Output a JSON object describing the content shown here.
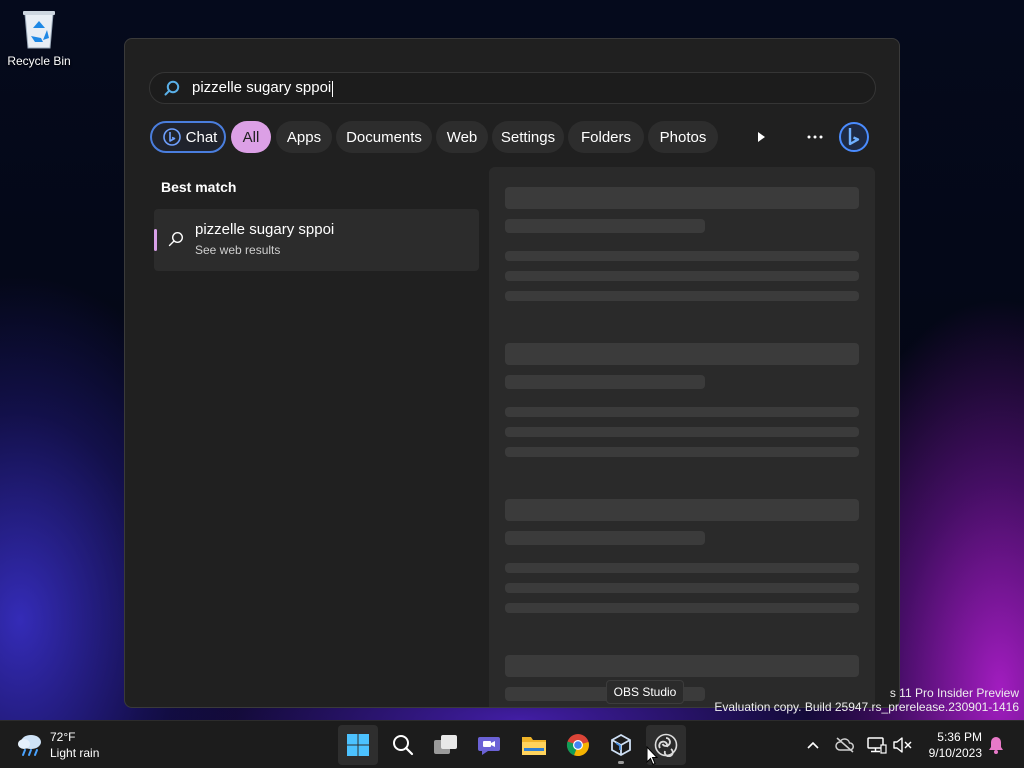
{
  "desktop": {
    "recycle_bin_label": "Recycle Bin"
  },
  "search": {
    "query": "pizzelle sugary sppoi",
    "filters": [
      {
        "label": "Chat"
      },
      {
        "label": "All"
      },
      {
        "label": "Apps"
      },
      {
        "label": "Documents"
      },
      {
        "label": "Web"
      },
      {
        "label": "Settings"
      },
      {
        "label": "Folders"
      },
      {
        "label": "Photos"
      }
    ],
    "active_filter": "All",
    "best_match_heading": "Best match",
    "best_match": {
      "title": "pizzelle sugary sppoi",
      "subtitle": "See web results"
    }
  },
  "watermark": {
    "line1": "s 11 Pro Insider Preview",
    "line2": "Evaluation copy. Build 25947.rs_prerelease.230901-1416"
  },
  "tooltip": {
    "text": "OBS Studio"
  },
  "taskbar": {
    "weather": {
      "temp": "72°F",
      "condition": "Light rain"
    },
    "clock": {
      "time": "5:36 PM",
      "date": "9/10/2023"
    }
  },
  "colors": {
    "accent": "#dca0e6",
    "bing_blue": "#4a7ede",
    "panel_bg": "#202020"
  }
}
